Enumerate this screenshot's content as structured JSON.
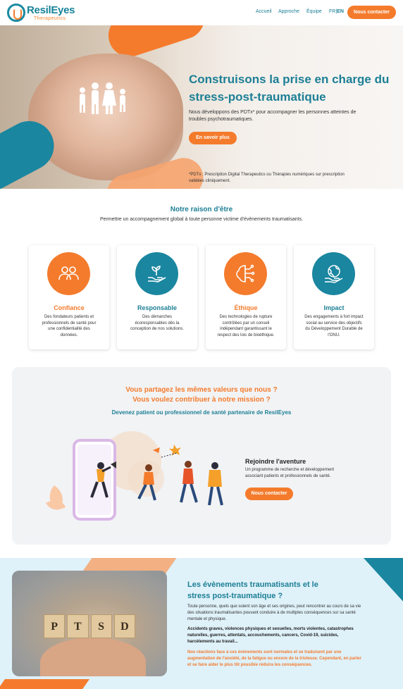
{
  "header": {
    "logo_name": "ResilEyes",
    "logo_sub": "Therapeutics",
    "nav": [
      "Accueil",
      "Approche",
      "Équipe"
    ],
    "lang_fr": "FR",
    "lang_sep": "|",
    "lang_en": "EN",
    "cta": "Nous contacter"
  },
  "hero": {
    "title": "Construisons la prise en charge du stress-post-traumatique",
    "description": "Nous développons des PDTx* pour accompagner les personnes atteintes de troubles psychotraumatiques.",
    "cta": "En savoir plus",
    "note": "*PDTx : Prescription Digital Therapeutics ou Thérapies numériques sur prescription validées cliniquement."
  },
  "raison": {
    "title": "Notre raison d'être",
    "subtitle": "Permettre un accompagnement global à toute personne victime d'évènements traumatisants.",
    "cards": [
      {
        "title": "Confiance",
        "text": "Des fondateurs patients et professionnels de santé pour une confidentialité des données.",
        "icon": "people-icon",
        "color": "#f47b2c"
      },
      {
        "title": "Responsable",
        "text": "Des démarches écoresponsables dès la conception de nos solutions.",
        "icon": "plant-hand-icon",
        "color": "#1a86a0"
      },
      {
        "title": "Éthique",
        "text": "Des technologies de rupture contrôlées par un conseil indépendant garantissant le respect des lois de bioéthique.",
        "icon": "brain-circuit-icon",
        "color": "#f47b2c"
      },
      {
        "title": "Impact",
        "text": "Des engagements à fort impact social au service des objectifs du Développement Durable de l'ONU.",
        "icon": "globe-hand-icon",
        "color": "#1a86a0"
      }
    ]
  },
  "valeurs": {
    "question1": "Vous partagez les mêmes valeurs que nous ?",
    "question2": "Vous voulez contribuer à notre mission ?",
    "subtitle": "Devenez patient ou professionnel de santé partenaire de ResilEyes",
    "join_title": "Rejoindre l'aventure",
    "join_text": "Un programme de recherche et développement associant patients et professionnels de santé.",
    "cta": "Nous contacter"
  },
  "evenements": {
    "title": "Les évènements traumatisants et le stress post-traumatique ?",
    "ptsd_letters": [
      "P",
      "T",
      "S",
      "D"
    ],
    "p1": "Toute personne, quels que soient son âge et ses origines, peut rencontrer au cours de sa vie des situations traumatisantes pouvant conduire à de multiples conséquences sur sa santé mentale et physique.",
    "p2": "Accidents graves, violences physiques et sexuelles, morts violentes, catastrophes naturelles, guerres, attentats, accouchements, cancers, Covid-19, suicides, harcèlements au travail...",
    "p3": "Nos réactions face à ces évènements sont normales et se traduisent par une augmentation de l'anxiété, de la fatigue ou encore de la tristesse. Cependant, en parler et se faire aider le plus tôt possible réduira les conséquences."
  },
  "colors": {
    "orange": "#f47b2c",
    "teal": "#1a86a0"
  }
}
